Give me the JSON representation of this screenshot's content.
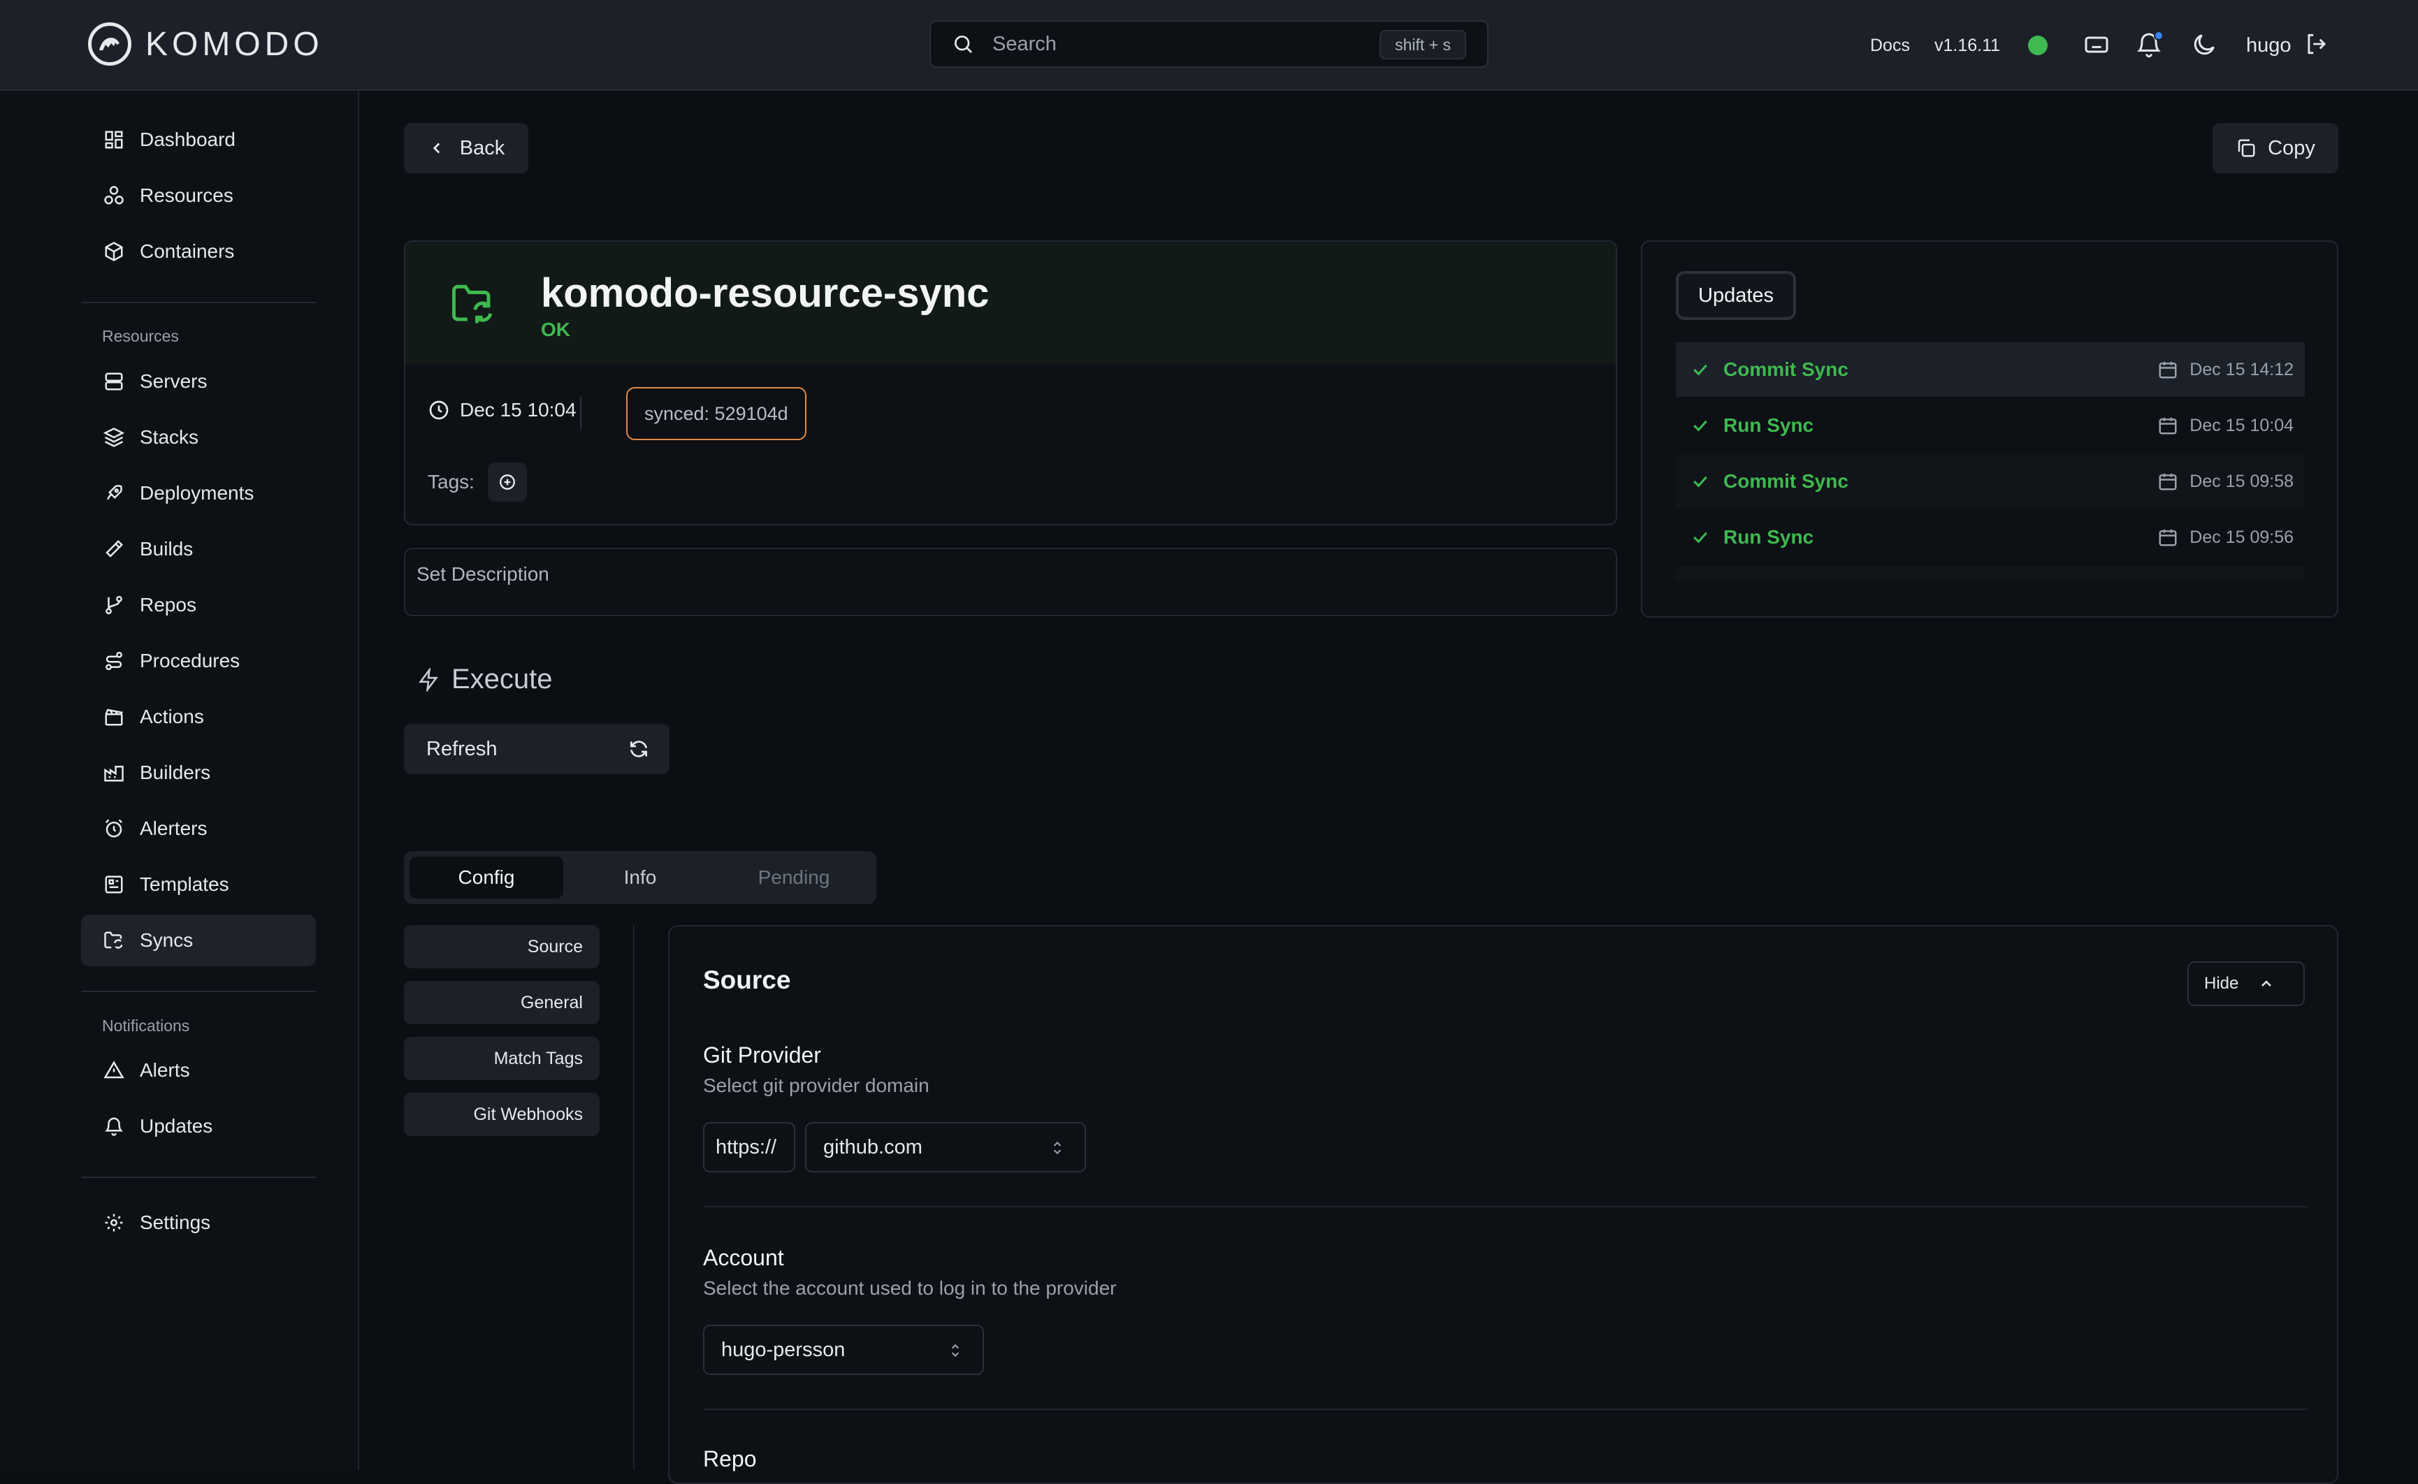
{
  "app": {
    "name": "KOMODO"
  },
  "topbar": {
    "search_placeholder": "Search",
    "search_shortcut": "shift + s",
    "docs_label": "Docs",
    "version": "v1.16.11",
    "status_color": "#3fb950",
    "user": "hugo"
  },
  "sidebar": {
    "top_items": [
      {
        "label": "Dashboard",
        "icon": "dashboard-icon"
      },
      {
        "label": "Resources",
        "icon": "boxes-icon"
      },
      {
        "label": "Containers",
        "icon": "container-icon"
      }
    ],
    "resources_heading": "Resources",
    "resource_items": [
      {
        "label": "Servers",
        "icon": "server-icon"
      },
      {
        "label": "Stacks",
        "icon": "layers-icon"
      },
      {
        "label": "Deployments",
        "icon": "rocket-icon"
      },
      {
        "label": "Builds",
        "icon": "hammer-icon"
      },
      {
        "label": "Repos",
        "icon": "git-branch-icon"
      },
      {
        "label": "Procedures",
        "icon": "route-icon"
      },
      {
        "label": "Actions",
        "icon": "clapperboard-icon"
      },
      {
        "label": "Builders",
        "icon": "factory-icon"
      },
      {
        "label": "Alerters",
        "icon": "alarm-clock-icon"
      },
      {
        "label": "Templates",
        "icon": "template-icon"
      },
      {
        "label": "Syncs",
        "icon": "folder-sync-icon",
        "active": true
      }
    ],
    "notifications_heading": "Notifications",
    "notification_items": [
      {
        "label": "Alerts",
        "icon": "alert-triangle-icon"
      },
      {
        "label": "Updates",
        "icon": "bell-icon"
      }
    ],
    "settings_label": "Settings"
  },
  "toolbar": {
    "back_label": "Back",
    "copy_label": "Copy"
  },
  "resource": {
    "name": "komodo-resource-sync",
    "state": "OK",
    "last_sync": "Dec 15 10:04",
    "synced_hash": "synced: 529104d",
    "tags_label": "Tags:",
    "description_placeholder": "Set Description"
  },
  "updates": {
    "tab_label": "Updates",
    "items": [
      {
        "title": "Commit Sync",
        "date": "Dec 15 14:12"
      },
      {
        "title": "Run Sync",
        "date": "Dec 15 10:04"
      },
      {
        "title": "Commit Sync",
        "date": "Dec 15 09:58"
      },
      {
        "title": "Run Sync",
        "date": "Dec 15 09:56"
      }
    ]
  },
  "execute": {
    "title": "Execute",
    "refresh_label": "Refresh"
  },
  "tabs": [
    {
      "label": "Config",
      "active": true
    },
    {
      "label": "Info"
    },
    {
      "label": "Pending",
      "disabled": true
    }
  ],
  "config_nav": [
    "Source",
    "General",
    "Match Tags",
    "Git Webhooks"
  ],
  "config": {
    "section_title": "Source",
    "hide_label": "Hide",
    "git_provider": {
      "label": "Git Provider",
      "description": "Select git provider domain",
      "protocol": "https://",
      "domain": "github.com"
    },
    "account": {
      "label": "Account",
      "description": "Select the account used to log in to the provider",
      "value": "hugo-persson"
    },
    "repo": {
      "label": "Repo"
    }
  },
  "colors": {
    "accent_green": "#3fb950",
    "badge_orange": "#e08a4a",
    "background": "#0b0e13"
  }
}
